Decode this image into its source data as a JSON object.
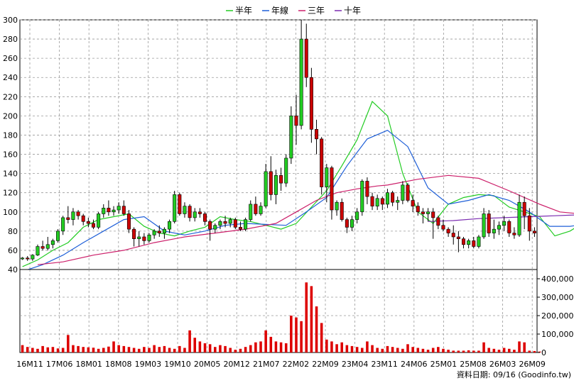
{
  "chart_data": [
    {
      "type": "candlestick",
      "legend": [
        {
          "name": "半年",
          "color": "#22cc22"
        },
        {
          "name": "年線",
          "color": "#1e5fd8"
        },
        {
          "name": "三年",
          "color": "#cc1f6a"
        },
        {
          "name": "十年",
          "color": "#7a2bb0"
        }
      ],
      "ylim": [
        40,
        300
      ],
      "y_ticks": [
        40,
        60,
        80,
        100,
        120,
        140,
        160,
        180,
        200,
        220,
        240,
        260,
        280,
        300
      ],
      "x_tick_labels": [
        "16M11",
        "17M06",
        "18M01",
        "18M08",
        "19M03",
        "19M10",
        "20M05",
        "20M12",
        "21M07",
        "22M02",
        "22M09",
        "23M04",
        "23M11",
        "24M06",
        "25M01",
        "25M08",
        "26M03",
        "26M09"
      ],
      "up_color": "#22cc22",
      "down_color": "#cc0000",
      "series": [
        {
          "name": "半年",
          "x": [
            0,
            3,
            6,
            9,
            12,
            15,
            18,
            21,
            24,
            27,
            30,
            33,
            36,
            39,
            42,
            45,
            48,
            51,
            54,
            57,
            60,
            63,
            66,
            69,
            72,
            75,
            78,
            81,
            84,
            87,
            90,
            93,
            96,
            99,
            102,
            105,
            108,
            111,
            113
          ],
          "values": [
            43,
            50,
            60,
            68,
            84,
            92,
            95,
            98,
            85,
            78,
            75,
            80,
            84,
            95,
            92,
            90,
            86,
            82,
            88,
            105,
            122,
            148,
            175,
            215,
            200,
            140,
            100,
            88,
            108,
            115,
            118,
            117,
            105,
            100,
            95,
            75,
            80,
            90,
            86
          ]
        },
        {
          "name": "年線",
          "x": [
            0,
            4,
            8,
            12,
            16,
            20,
            24,
            28,
            32,
            36,
            40,
            44,
            48,
            52,
            56,
            60,
            64,
            68,
            72,
            76,
            80,
            84,
            88,
            92,
            96,
            100,
            104,
            108,
            112,
            113
          ],
          "values": [
            38,
            45,
            55,
            68,
            80,
            92,
            95,
            80,
            76,
            80,
            86,
            88,
            87,
            86,
            100,
            115,
            148,
            176,
            185,
            168,
            125,
            108,
            112,
            118,
            112,
            100,
            85,
            85,
            88,
            90
          ]
        },
        {
          "name": "三年",
          "x": [
            3,
            8,
            14,
            20,
            26,
            32,
            38,
            44,
            50,
            54,
            58,
            62,
            66,
            70,
            72,
            78,
            84,
            90,
            96,
            102,
            106,
            110,
            113
          ],
          "values": [
            45,
            48,
            55,
            60,
            68,
            74,
            78,
            82,
            88,
            100,
            112,
            120,
            124,
            127,
            128,
            134,
            138,
            135,
            122,
            108,
            100,
            98,
            96
          ]
        },
        {
          "name": "十年",
          "x": [
            80,
            85,
            90,
            95,
            100,
            105,
            110,
            113
          ],
          "values": [
            90,
            91,
            93,
            94,
            95,
            96,
            97,
            98
          ]
        }
      ],
      "candles": [
        [
          51,
          53,
          50,
          52
        ],
        [
          52,
          54,
          49,
          51
        ],
        [
          51,
          56,
          49,
          55
        ],
        [
          55,
          66,
          54,
          64
        ],
        [
          64,
          70,
          60,
          62
        ],
        [
          62,
          74,
          60,
          66
        ],
        [
          66,
          72,
          62,
          70
        ],
        [
          70,
          82,
          68,
          80
        ],
        [
          80,
          96,
          76,
          94
        ],
        [
          94,
          106,
          88,
          92
        ],
        [
          92,
          104,
          86,
          100
        ],
        [
          100,
          102,
          92,
          96
        ],
        [
          96,
          98,
          86,
          90
        ],
        [
          90,
          94,
          84,
          88
        ],
        [
          88,
          92,
          82,
          84
        ],
        [
          84,
          100,
          82,
          98
        ],
        [
          98,
          108,
          94,
          104
        ],
        [
          104,
          112,
          96,
          100
        ],
        [
          100,
          106,
          96,
          102
        ],
        [
          102,
          110,
          98,
          106
        ],
        [
          106,
          112,
          96,
          98
        ],
        [
          98,
          102,
          78,
          82
        ],
        [
          82,
          84,
          64,
          72
        ],
        [
          72,
          80,
          64,
          74
        ],
        [
          74,
          78,
          66,
          70
        ],
        [
          70,
          78,
          68,
          76
        ],
        [
          76,
          82,
          72,
          80
        ],
        [
          80,
          86,
          74,
          78
        ],
        [
          78,
          84,
          72,
          82
        ],
        [
          82,
          92,
          78,
          90
        ],
        [
          90,
          122,
          88,
          118
        ],
        [
          118,
          120,
          96,
          98
        ],
        [
          98,
          110,
          94,
          106
        ],
        [
          106,
          108,
          90,
          94
        ],
        [
          94,
          104,
          90,
          100
        ],
        [
          100,
          104,
          94,
          98
        ],
        [
          98,
          100,
          86,
          90
        ],
        [
          90,
          92,
          70,
          82
        ],
        [
          82,
          88,
          78,
          86
        ],
        [
          86,
          92,
          82,
          90
        ],
        [
          90,
          96,
          84,
          88
        ],
        [
          88,
          94,
          84,
          92
        ],
        [
          92,
          94,
          82,
          84
        ],
        [
          84,
          90,
          80,
          82
        ],
        [
          82,
          94,
          80,
          92
        ],
        [
          92,
          112,
          90,
          108
        ],
        [
          108,
          116,
          96,
          98
        ],
        [
          98,
          110,
          96,
          106
        ],
        [
          106,
          150,
          104,
          142
        ],
        [
          142,
          158,
          112,
          118
        ],
        [
          118,
          144,
          108,
          138
        ],
        [
          138,
          146,
          122,
          130
        ],
        [
          130,
          160,
          126,
          156
        ],
        [
          156,
          210,
          150,
          200
        ],
        [
          200,
          222,
          170,
          190
        ],
        [
          190,
          300,
          186,
          280
        ],
        [
          280,
          296,
          230,
          240
        ],
        [
          240,
          250,
          172,
          186
        ],
        [
          186,
          196,
          160,
          176
        ],
        [
          176,
          178,
          118,
          126
        ],
        [
          126,
          150,
          110,
          146
        ],
        [
          146,
          148,
          92,
          102
        ],
        [
          102,
          112,
          96,
          110
        ],
        [
          110,
          114,
          90,
          92
        ],
        [
          92,
          94,
          78,
          84
        ],
        [
          84,
          96,
          80,
          92
        ],
        [
          92,
          104,
          88,
          100
        ],
        [
          100,
          134,
          96,
          132
        ],
        [
          132,
          136,
          108,
          116
        ],
        [
          116,
          120,
          102,
          106
        ],
        [
          106,
          118,
          102,
          114
        ],
        [
          114,
          116,
          102,
          108
        ],
        [
          108,
          124,
          104,
          120
        ],
        [
          120,
          122,
          106,
          110
        ],
        [
          110,
          116,
          102,
          112
        ],
        [
          112,
          132,
          108,
          128
        ],
        [
          128,
          130,
          110,
          112
        ],
        [
          112,
          118,
          100,
          106
        ],
        [
          106,
          110,
          96,
          100
        ],
        [
          100,
          104,
          88,
          98
        ],
        [
          98,
          104,
          90,
          100
        ],
        [
          100,
          104,
          72,
          94
        ],
        [
          94,
          96,
          82,
          86
        ],
        [
          86,
          92,
          80,
          82
        ],
        [
          82,
          84,
          74,
          78
        ],
        [
          78,
          86,
          66,
          74
        ],
        [
          74,
          80,
          58,
          72
        ],
        [
          72,
          74,
          62,
          66
        ],
        [
          66,
          72,
          62,
          70
        ],
        [
          70,
          74,
          62,
          64
        ],
        [
          64,
          76,
          62,
          74
        ],
        [
          74,
          104,
          72,
          98
        ],
        [
          98,
          102,
          74,
          78
        ],
        [
          78,
          92,
          72,
          82
        ],
        [
          82,
          90,
          76,
          86
        ],
        [
          86,
          96,
          80,
          90
        ],
        [
          90,
          92,
          74,
          78
        ],
        [
          78,
          84,
          72,
          76
        ],
        [
          76,
          118,
          74,
          110
        ],
        [
          110,
          116,
          82,
          96
        ],
        [
          96,
          104,
          70,
          80
        ],
        [
          80,
          84,
          74,
          78
        ]
      ],
      "volume": {
        "ylim": [
          0,
          450000
        ],
        "y_ticks": [
          0,
          100000,
          200000,
          300000,
          400000
        ],
        "y_tick_labels": [
          "0",
          "100,000",
          "200,000",
          "300,000",
          "400,000"
        ],
        "color": "#dd0000",
        "values": [
          40000,
          30000,
          25000,
          20000,
          35000,
          28000,
          30000,
          22000,
          25000,
          95000,
          40000,
          35000,
          30000,
          28000,
          26000,
          20000,
          25000,
          32000,
          60000,
          40000,
          35000,
          30000,
          25000,
          20000,
          30000,
          25000,
          40000,
          30000,
          35000,
          25000,
          20000,
          35000,
          25000,
          120000,
          80000,
          60000,
          50000,
          45000,
          30000,
          40000,
          35000,
          25000,
          15000,
          20000,
          30000,
          40000,
          55000,
          60000,
          120000,
          85000,
          60000,
          55000,
          50000,
          200000,
          190000,
          170000,
          380000,
          360000,
          250000,
          160000,
          70000,
          60000,
          45000,
          55000,
          40000,
          35000,
          30000,
          25000,
          60000,
          40000,
          25000,
          20000,
          35000,
          30000,
          25000,
          20000,
          45000,
          30000,
          25000,
          20000,
          15000,
          25000,
          30000,
          20000,
          15000,
          10000,
          10000,
          10000,
          12000,
          10000,
          10000,
          55000,
          25000,
          20000,
          15000,
          25000,
          20000,
          15000,
          60000,
          55000,
          10000,
          8000,
          5000
        ]
      },
      "footer": "資料日期: 09/16 (Goodinfo.tw)"
    }
  ]
}
